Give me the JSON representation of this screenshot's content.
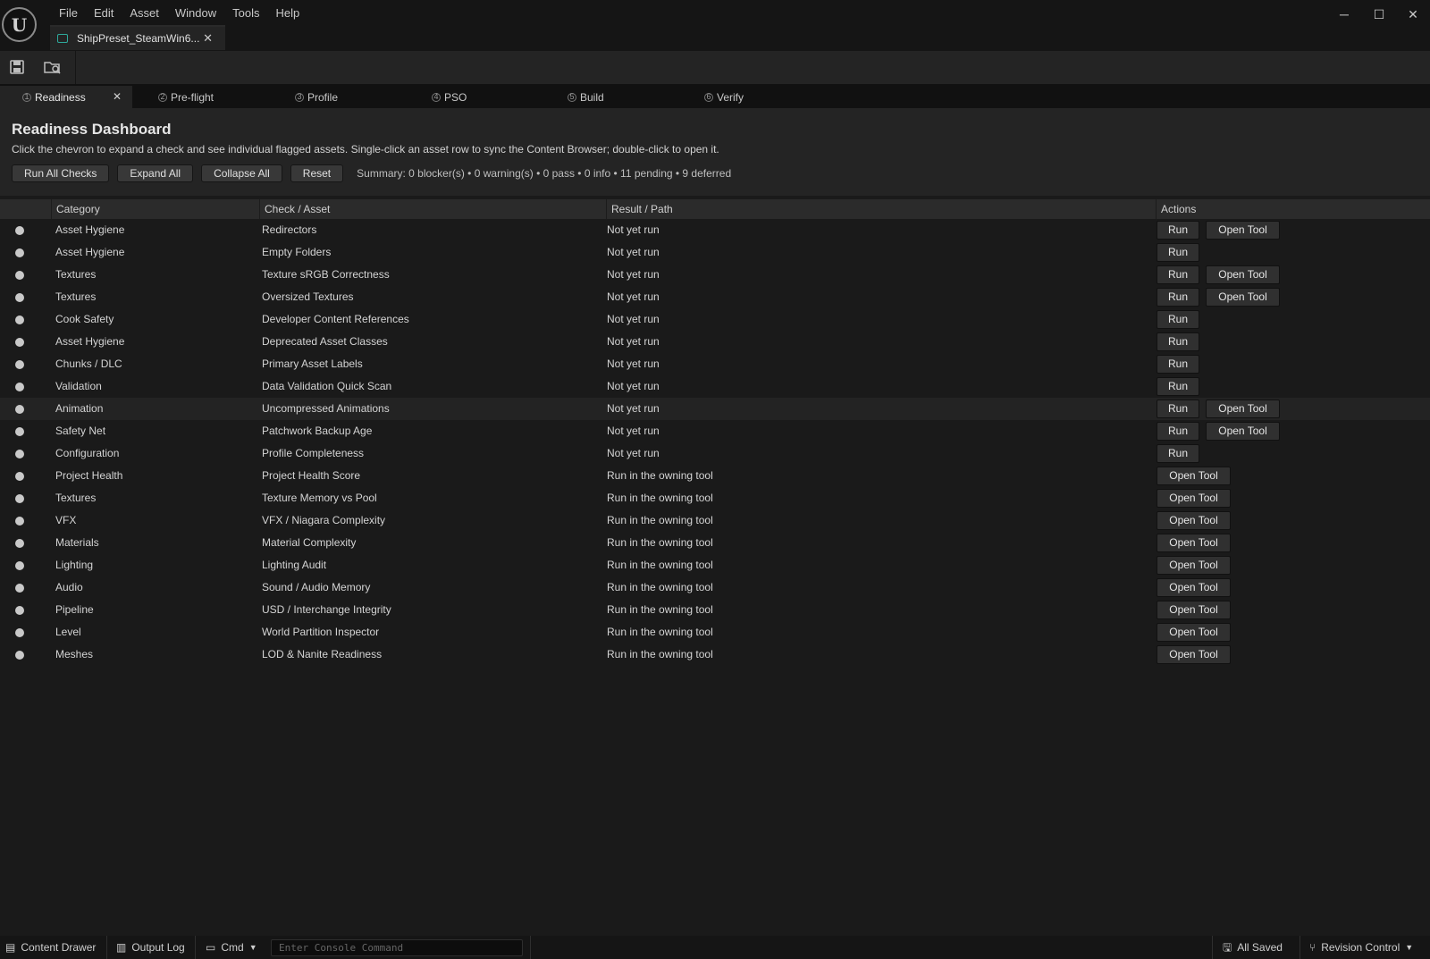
{
  "app": {
    "menu": [
      "File",
      "Edit",
      "Asset",
      "Window",
      "Tools",
      "Help"
    ],
    "document_tab": "ShipPreset_SteamWin6...",
    "window_controls": {
      "minimize": "─",
      "maximize": "☐",
      "close": "✕"
    }
  },
  "toolbar": {
    "save_icon": "save-icon",
    "browse_icon": "browse-asset-icon"
  },
  "tool_tabs": [
    {
      "num": "1",
      "label": "Readiness"
    },
    {
      "num": "2",
      "label": "Pre-flight"
    },
    {
      "num": "3",
      "label": "Profile"
    },
    {
      "num": "4",
      "label": "PSO"
    },
    {
      "num": "5",
      "label": "Build"
    },
    {
      "num": "6",
      "label": "Verify"
    }
  ],
  "dashboard": {
    "title": "Readiness Dashboard",
    "subtitle": "Click the chevron to expand a check and see individual flagged assets. Single-click an asset row to sync the Content Browser; double-click to open it.",
    "buttons": {
      "run_all": "Run All Checks",
      "expand_all": "Expand All",
      "collapse_all": "Collapse All",
      "reset": "Reset"
    },
    "summary": "Summary: 0 blocker(s) • 0 warning(s) • 0 pass • 0 info • 11 pending • 9 deferred"
  },
  "table": {
    "headers": {
      "category": "Category",
      "check": "Check / Asset",
      "result": "Result / Path",
      "actions": "Actions"
    },
    "run_label": "Run",
    "open_label": "Open Tool",
    "rows": [
      {
        "category": "Asset Hygiene",
        "check": "Redirectors",
        "result": "Not yet run",
        "run": true,
        "open": true
      },
      {
        "category": "Asset Hygiene",
        "check": "Empty Folders",
        "result": "Not yet run",
        "run": true,
        "open": false
      },
      {
        "category": "Textures",
        "check": "Texture sRGB Correctness",
        "result": "Not yet run",
        "run": true,
        "open": true
      },
      {
        "category": "Textures",
        "check": "Oversized Textures",
        "result": "Not yet run",
        "run": true,
        "open": true
      },
      {
        "category": "Cook Safety",
        "check": "Developer Content References",
        "result": "Not yet run",
        "run": true,
        "open": false
      },
      {
        "category": "Asset Hygiene",
        "check": "Deprecated Asset Classes",
        "result": "Not yet run",
        "run": true,
        "open": false
      },
      {
        "category": "Chunks / DLC",
        "check": "Primary Asset Labels",
        "result": "Not yet run",
        "run": true,
        "open": false
      },
      {
        "category": "Validation",
        "check": "Data Validation Quick Scan",
        "result": "Not yet run",
        "run": true,
        "open": false
      },
      {
        "category": "Animation",
        "check": "Uncompressed Animations",
        "result": "Not yet run",
        "run": true,
        "open": true
      },
      {
        "category": "Safety Net",
        "check": "Patchwork Backup Age",
        "result": "Not yet run",
        "run": true,
        "open": true
      },
      {
        "category": "Configuration",
        "check": "Profile Completeness",
        "result": "Not yet run",
        "run": true,
        "open": false
      },
      {
        "category": "Project Health",
        "check": "Project Health Score",
        "result": "Run in the owning tool",
        "run": false,
        "open": true
      },
      {
        "category": "Textures",
        "check": "Texture Memory vs Pool",
        "result": "Run in the owning tool",
        "run": false,
        "open": true
      },
      {
        "category": "VFX",
        "check": "VFX / Niagara Complexity",
        "result": "Run in the owning tool",
        "run": false,
        "open": true
      },
      {
        "category": "Materials",
        "check": "Material Complexity",
        "result": "Run in the owning tool",
        "run": false,
        "open": true
      },
      {
        "category": "Lighting",
        "check": "Lighting Audit",
        "result": "Run in the owning tool",
        "run": false,
        "open": true
      },
      {
        "category": "Audio",
        "check": "Sound / Audio Memory",
        "result": "Run in the owning tool",
        "run": false,
        "open": true
      },
      {
        "category": "Pipeline",
        "check": "USD / Interchange Integrity",
        "result": "Run in the owning tool",
        "run": false,
        "open": true
      },
      {
        "category": "Level",
        "check": "World Partition Inspector",
        "result": "Run in the owning tool",
        "run": false,
        "open": true
      },
      {
        "category": "Meshes",
        "check": "LOD & Nanite Readiness",
        "result": "Run in the owning tool",
        "run": false,
        "open": true
      }
    ]
  },
  "statusbar": {
    "content_drawer": "Content Drawer",
    "output_log": "Output Log",
    "cmd": "Cmd",
    "console_placeholder": "Enter Console Command",
    "all_saved": "All Saved",
    "revision_control": "Revision Control"
  }
}
